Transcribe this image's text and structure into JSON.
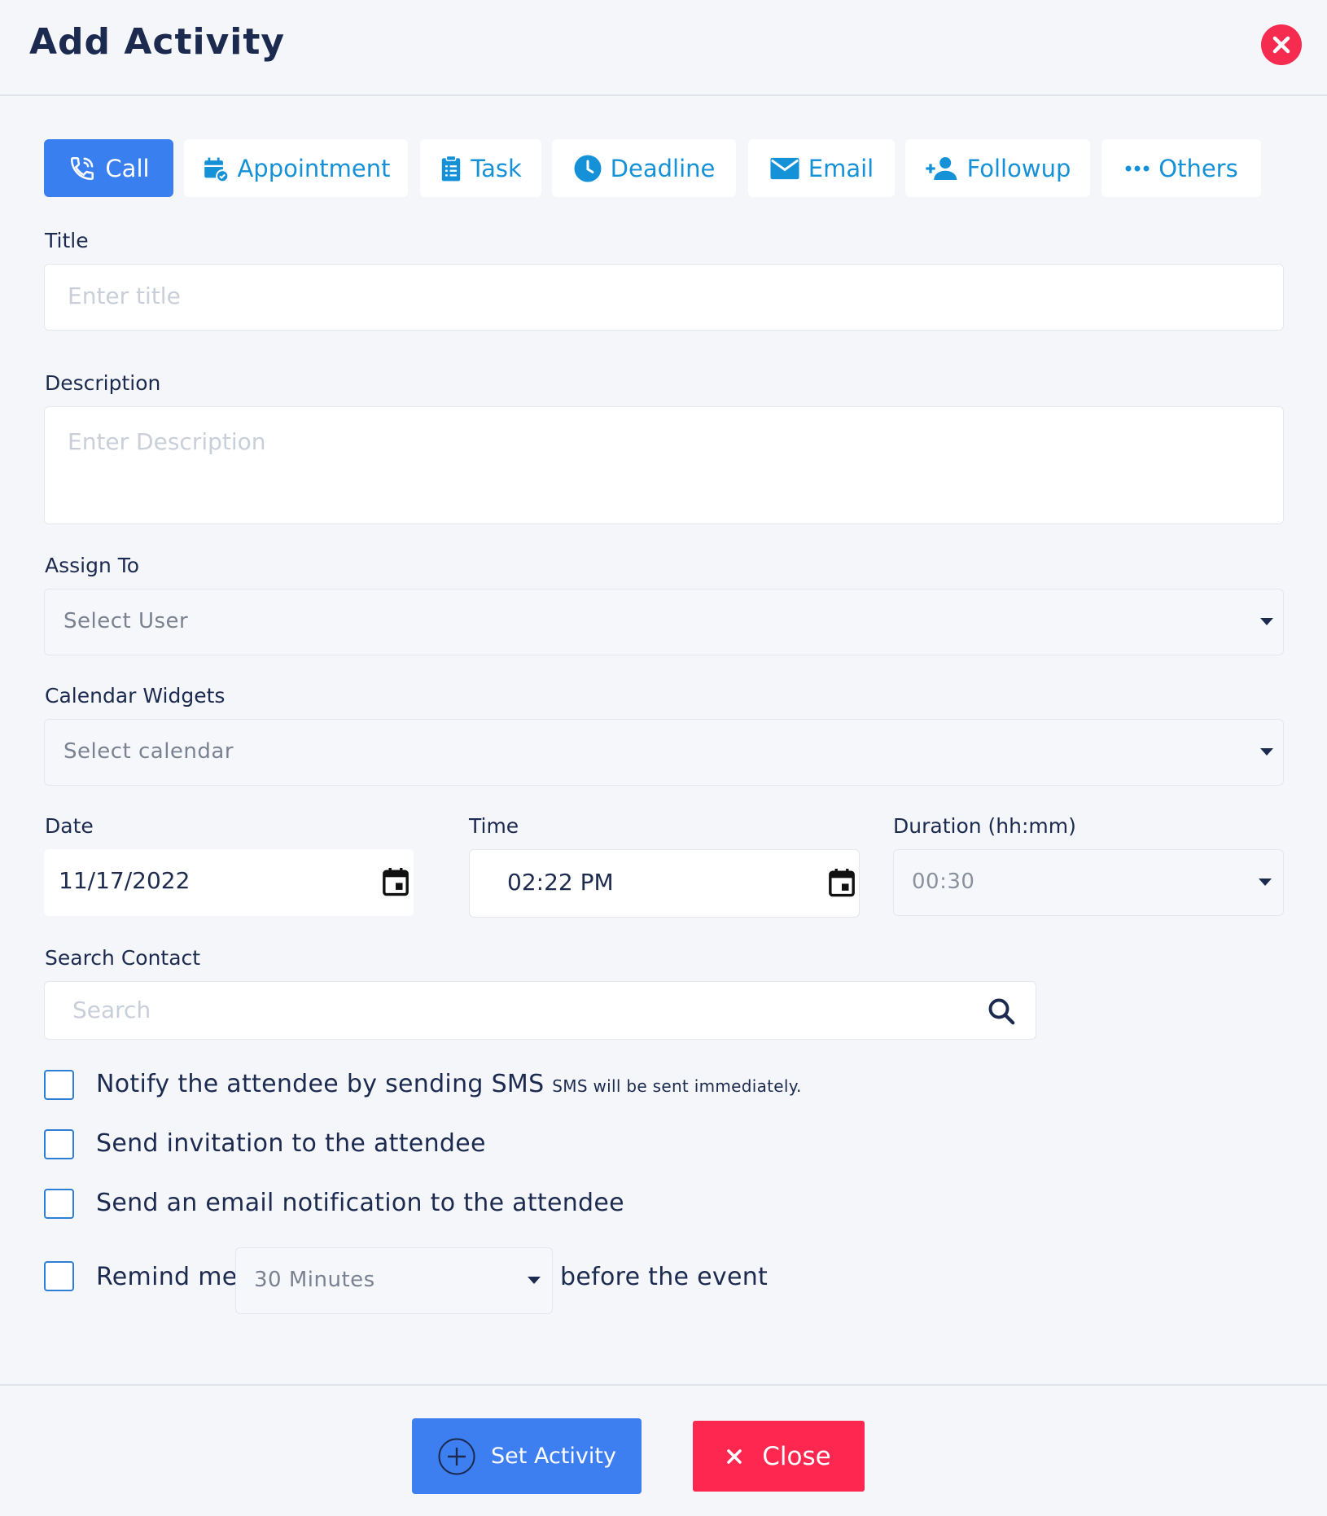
{
  "header": {
    "title": "Add Activity"
  },
  "tabs": [
    {
      "label": "Call",
      "icon": "phone-icon",
      "active": true
    },
    {
      "label": "Appointment",
      "icon": "calendar-check-icon"
    },
    {
      "label": "Task",
      "icon": "clipboard-list-icon"
    },
    {
      "label": "Deadline",
      "icon": "clock-icon"
    },
    {
      "label": "Email",
      "icon": "envelope-icon"
    },
    {
      "label": "Followup",
      "icon": "user-plus-icon"
    },
    {
      "label": "Others",
      "icon": "more-horizontal-icon"
    }
  ],
  "form": {
    "title_label": "Title",
    "title_placeholder": "Enter title",
    "description_label": "Description",
    "description_placeholder": "Enter Description",
    "assign_label": "Assign To",
    "assign_value": "Select User",
    "calendar_label": "Calendar Widgets",
    "calendar_value": "Select calendar",
    "date_label": "Date",
    "date_value": "11/17/2022",
    "time_label": "Time",
    "time_value": "02:22 PM",
    "duration_label": "Duration (hh:mm)",
    "duration_value": "00:30",
    "search_label": "Search Contact",
    "search_placeholder": "Search"
  },
  "options": {
    "sms_label": "Notify the attendee by sending SMS",
    "sms_note": "SMS will be sent immediately.",
    "invitation_label": "Send invitation to the attendee",
    "email_label": "Send an email notification to the attendee",
    "remind_label": "Remind me",
    "remind_value": "30 Minutes",
    "remind_suffix": "before the event"
  },
  "footer": {
    "set_label": "Set Activity",
    "close_label": "Close"
  },
  "colors": {
    "primary": "#3a7ff0",
    "tab_text": "#1591d8",
    "danger": "#fe2750",
    "text": "#1b2a4e"
  }
}
